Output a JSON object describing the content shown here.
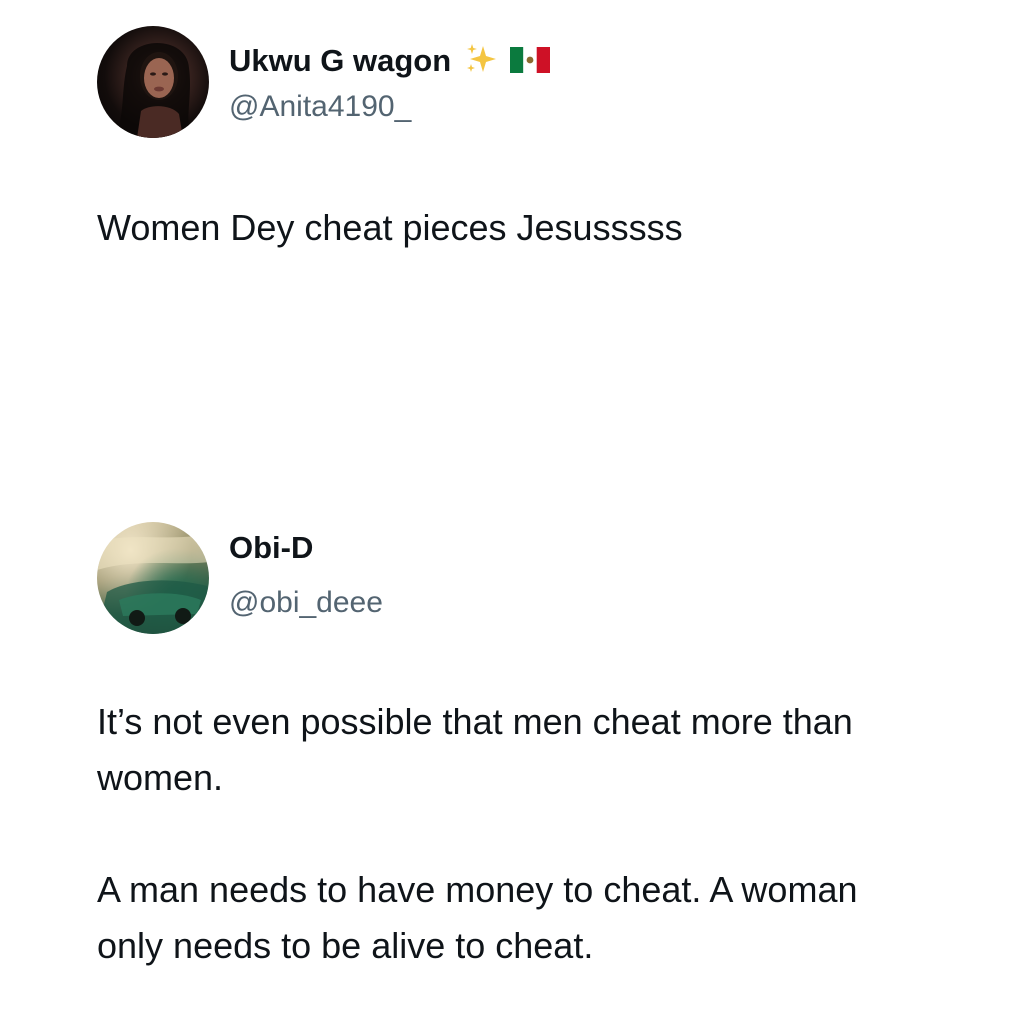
{
  "tweets": [
    {
      "display_name": "Ukwu G wagon",
      "name_emojis": [
        "sparkles-icon",
        "mexico-flag-icon"
      ],
      "handle": "@Anita4190_",
      "text": "Women Dey cheat pieces Jesusssss"
    },
    {
      "display_name": "Obi-D",
      "handle": "@obi_deee",
      "paragraphs": [
        "It’s not even possible that men cheat more than women.",
        "A man needs to have money to cheat. A woman only needs to be alive to cheat."
      ]
    }
  ],
  "colors": {
    "text": "#0f1419",
    "secondary": "#536471",
    "background": "#ffffff"
  }
}
